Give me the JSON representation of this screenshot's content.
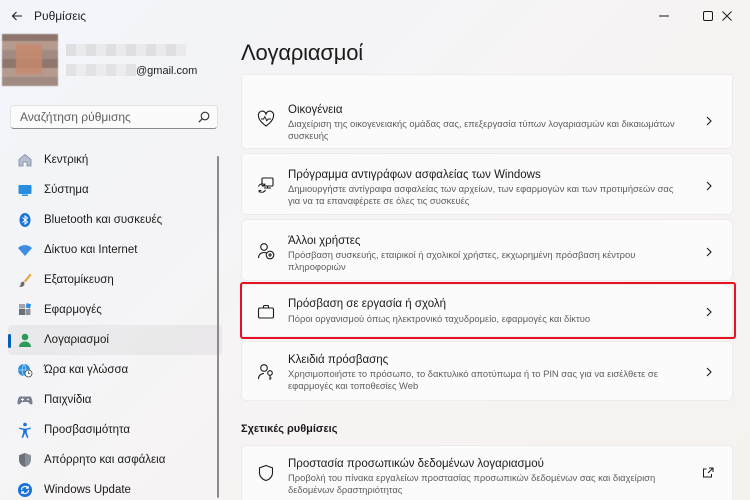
{
  "window": {
    "title": "Ρυθμίσεις",
    "controls": [
      "minimize-icon",
      "maximize-icon",
      "close-icon"
    ]
  },
  "profile": {
    "email": "@gmail.com"
  },
  "search": {
    "placeholder": "Αναζήτηση ρύθμισης"
  },
  "sidebar": {
    "items": [
      {
        "label": "Κεντρική",
        "icon": "home-icon",
        "active": false
      },
      {
        "label": "Σύστημα",
        "icon": "system-icon",
        "active": false
      },
      {
        "label": "Bluetooth και συσκευές",
        "icon": "bluetooth-icon",
        "active": false
      },
      {
        "label": "Δίκτυο και Internet",
        "icon": "wifi-icon",
        "active": false
      },
      {
        "label": "Εξατομίκευση",
        "icon": "brush-icon",
        "active": false
      },
      {
        "label": "Εφαρμογές",
        "icon": "apps-icon",
        "active": false
      },
      {
        "label": "Λογαριασμοί",
        "icon": "accounts-icon",
        "active": true
      },
      {
        "label": "Ώρα και γλώσσα",
        "icon": "globe-clock-icon",
        "active": false
      },
      {
        "label": "Παιχνίδια",
        "icon": "gamepad-icon",
        "active": false
      },
      {
        "label": "Προσβασιμότητα",
        "icon": "accessibility-icon",
        "active": false
      },
      {
        "label": "Απόρρητο και ασφάλεια",
        "icon": "shield-icon",
        "active": false
      },
      {
        "label": "Windows Update",
        "icon": "update-icon",
        "active": false
      }
    ]
  },
  "main": {
    "title": "Λογαριασμοί",
    "cards": [
      {
        "title": "Οικογένεια",
        "desc": "Διαχείριση της οικογενειακής ομάδας σας, επεξεργασία τύπων λογαριασμών και δικαιωμάτων συσκευής",
        "icon": "family-heart-icon"
      },
      {
        "title": "Πρόγραμμα αντιγράφων ασφαλείας των Windows",
        "desc": "Δημιουργήστε αντίγραφα ασφαλείας των αρχείων, των εφαρμογών και των προτιμήσεών σας για να τα επαναφέρετε σε όλες τις συσκευές",
        "icon": "backup-icon"
      },
      {
        "title": "Άλλοι χρήστες",
        "desc": "Πρόσβαση συσκευής, εταιρικοί ή σχολικοί χρήστες, εκχωρημένη πρόσβαση κέντρου πληροφοριών",
        "icon": "add-user-icon"
      },
      {
        "title": "Πρόσβαση σε εργασία ή σχολή",
        "desc": "Πόροι οργανισμού όπως ηλεκτρονικό ταχυδρομείο, εφαρμογές και δίκτυο",
        "icon": "briefcase-icon"
      },
      {
        "title": "Κλειδιά πρόσβασης",
        "desc": "Χρησιμοποιήστε το πρόσωπο, το δακτυλικό αποτύπωμα ή το PIN σας για να εισέλθετε σε εφαρμογές και τοποθεσίες Web",
        "icon": "passkey-icon"
      }
    ],
    "related_label": "Σχετικές ρυθμίσεις",
    "related": [
      {
        "title": "Προστασία προσωπικών δεδομένων λογαριασμού",
        "desc": "Προβολή του πίνακα εργαλείων προστασίας προσωπικών δεδομένων σας και διαχείριση δεδομένων δραστηριότητας",
        "icon": "shield-outline-icon"
      }
    ]
  },
  "colors": {
    "accent": "#005fb8",
    "highlight": "#e81123"
  }
}
